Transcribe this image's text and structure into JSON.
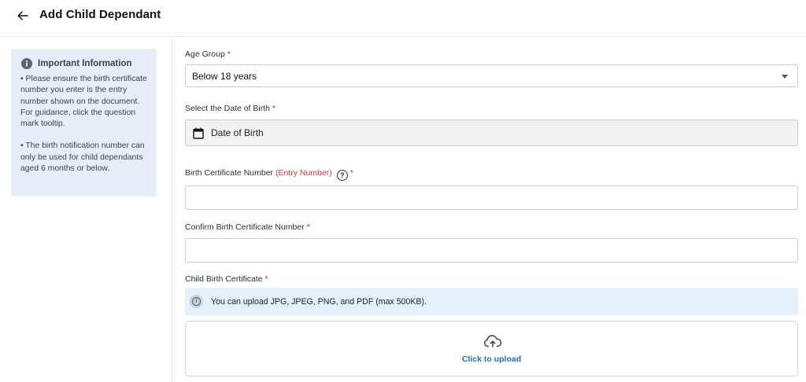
{
  "header": {
    "title": "Add Child Dependant"
  },
  "info": {
    "title": "Important Information",
    "bullet1": "• Please ensure the birth certificate number you enter is the entry number shown on the document. For guidance, click the question mark tooltip.",
    "bullet2": "• The birth notification number can only be used for child dependants aged 6 months or below."
  },
  "form": {
    "age_group": {
      "label": "Age Group",
      "required": "*",
      "value": "Below 18 years"
    },
    "dob": {
      "label": "Select the Date of Birth",
      "required": "*",
      "placeholder": "Date of Birth"
    },
    "birth_cert": {
      "label": "Birth Certificate Number",
      "entry_note": "(Entry Number)",
      "help": "?",
      "required": "*",
      "value": ""
    },
    "confirm_cert": {
      "label": "Confirm Birth Certificate Number",
      "required": "*",
      "value": ""
    },
    "cert_upload": {
      "label": "Child Birth Certificate",
      "required": "*",
      "note": "You can upload JPG, JPEG, PNG, and PDF (max 500KB).",
      "note_icon": "i",
      "cta": "Click to upload"
    }
  },
  "colors": {
    "accent": "#1f6fc5",
    "required": "#e11d2e",
    "info_bg": "#e6eef9",
    "note_bg": "#e4f0fb"
  },
  "icons": {
    "back": "arrow-left-icon",
    "info": "info-circle-icon",
    "calendar": "calendar-icon",
    "help": "question-circle-icon",
    "note": "info-icon",
    "upload": "cloud-upload-icon",
    "caret": "caret-down-icon"
  }
}
